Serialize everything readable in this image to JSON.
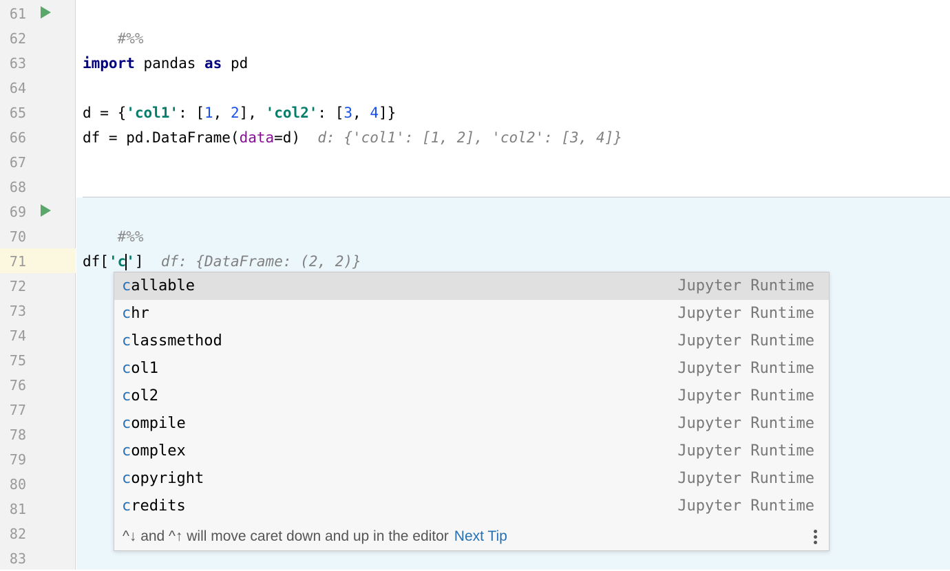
{
  "editor": {
    "line_numbers": [
      "61",
      "62",
      "63",
      "64",
      "65",
      "66",
      "67",
      "68",
      "69",
      "70",
      "71",
      "72",
      "73",
      "74",
      "75",
      "76",
      "77",
      "78",
      "79",
      "80",
      "81",
      "82",
      "83"
    ],
    "cell1_marker": "#%%",
    "import_kw": "import",
    "import_mod": " pandas ",
    "as_kw": "as",
    "import_alias": " pd",
    "line65": {
      "p1": "d = {",
      "s1": "'col1'",
      "p2": ": [",
      "n1": "1",
      "p3": ", ",
      "n2": "2",
      "p4": "], ",
      "s2": "'col2'",
      "p5": ": [",
      "n3": "3",
      "p6": ", ",
      "n4": "4",
      "p7": "]}"
    },
    "line66": {
      "p1": "df = pd.DataFrame(",
      "param": "data",
      "p2": "=d)",
      "hint": "d: {'col1': [1, 2], 'col2': [3, 4]}"
    },
    "cell2_marker": "#%%",
    "line71": {
      "p1": "df[",
      "s1": "'c",
      "s2": "'",
      "p2": "]",
      "hint": "df: {DataFrame: (2, 2)}"
    }
  },
  "completion": {
    "typed_prefix": "c",
    "items": [
      {
        "rest": "allable",
        "source": "Jupyter Runtime"
      },
      {
        "rest": "hr",
        "source": "Jupyter Runtime"
      },
      {
        "rest": "lassmethod",
        "source": "Jupyter Runtime"
      },
      {
        "rest": "ol1",
        "source": "Jupyter Runtime"
      },
      {
        "rest": "ol2",
        "source": "Jupyter Runtime"
      },
      {
        "rest": "ompile",
        "source": "Jupyter Runtime"
      },
      {
        "rest": "omplex",
        "source": "Jupyter Runtime"
      },
      {
        "rest": "opyright",
        "source": "Jupyter Runtime"
      },
      {
        "rest": "redits",
        "source": "Jupyter Runtime"
      }
    ],
    "tip_text": "^↓ and ^↑ will move caret down and up in the editor",
    "next_tip": "Next Tip"
  },
  "colors": {
    "run_icon": "#59a869",
    "match": "#2a72b9",
    "cell_bg": "#ecf7fb"
  },
  "icons": {
    "run": "run-cell-icon",
    "more": "more-vertical-icon"
  }
}
